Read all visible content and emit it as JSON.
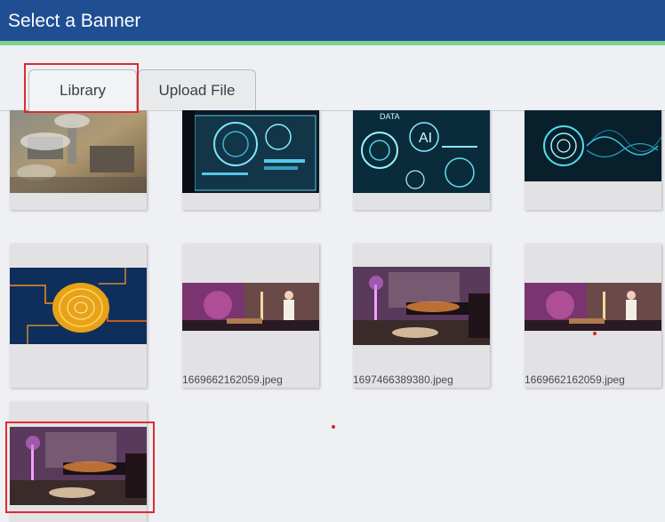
{
  "window": {
    "title": "Select a Banner"
  },
  "tabs": [
    {
      "label": "Library",
      "active": true
    },
    {
      "label": "Upload File",
      "active": false
    }
  ],
  "thumbnails": [
    {
      "scene": "industrial-city-aerial",
      "caption": ""
    },
    {
      "scene": "tech-monitor-hud",
      "caption": ""
    },
    {
      "scene": "data-ai-holograms",
      "caption": ""
    },
    {
      "scene": "fingerprint-scan",
      "caption": ""
    },
    {
      "scene": "circuit-fingerprint",
      "caption": ""
    },
    {
      "scene": "living-room-woman",
      "caption": "1669662162059.jpeg"
    },
    {
      "scene": "living-room-lights",
      "caption": "1697466389380.jpeg"
    },
    {
      "scene": "living-room-woman",
      "caption": "1669662162059.jpeg"
    },
    {
      "scene": "living-room-lights",
      "caption": ""
    }
  ],
  "colors": {
    "titlebar": "#1f4e93",
    "accent_stripe": "#7dd089",
    "highlight": "#e02a2e",
    "background": "#eef0f4"
  }
}
